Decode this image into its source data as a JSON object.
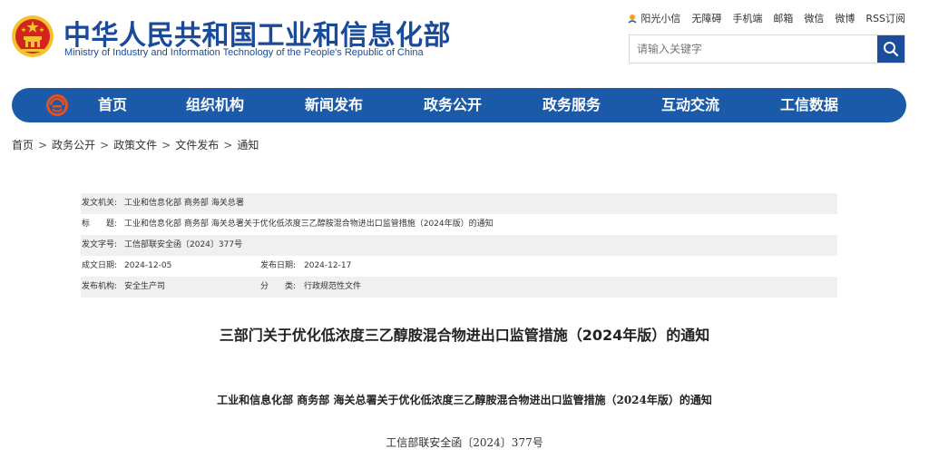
{
  "header": {
    "title": "中华人民共和国工业和信息化部",
    "subtitle": "Ministry of Industry and Information Technology of the People's Republic of China",
    "emblem_icon": "national-emblem-icon",
    "colors": {
      "brand": "#1a4a9a",
      "nav": "#1a5aa8",
      "emblem_red": "#d4241c",
      "emblem_gold": "#f4c430"
    }
  },
  "toplinks": {
    "items": [
      "阳光小信",
      "无障碍",
      "手机端",
      "邮箱",
      "微信",
      "微博",
      "RSS订阅"
    ],
    "first_icon": "sun-icon"
  },
  "search": {
    "placeholder": "请输入关键字",
    "value": "",
    "button_icon": "search-icon"
  },
  "nav": {
    "logo_icon": "ministry-logo-icon",
    "items": [
      "首页",
      "组织机构",
      "新闻发布",
      "政务公开",
      "政务服务",
      "互动交流",
      "工信数据"
    ]
  },
  "breadcrumb": {
    "items": [
      "首页",
      "政务公开",
      "政策文件",
      "文件发布",
      "通知"
    ],
    "separator": ">"
  },
  "meta": {
    "issuer_label": "发文机关:",
    "issuer_value": "工业和信息化部 商务部 海关总署",
    "title_label": "标　　题:",
    "title_value": "工业和信息化部 商务部 海关总署关于优化低浓度三乙醇胺混合物进出口监管措施（2024年版）的通知",
    "docno_label": "发文字号:",
    "docno_value": "工信部联安全函〔2024〕377号",
    "created_label": "成文日期:",
    "created_value": "2024-12-05",
    "published_label": "发布日期:",
    "published_value": "2024-12-17",
    "agency_label": "发布机构:",
    "agency_value": "安全生产司",
    "category_label": "分　　类:",
    "category_value": "行政规范性文件"
  },
  "article": {
    "title": "三部门关于优化低浓度三乙醇胺混合物进出口监管措施（2024年版）的通知",
    "subtitle": "工业和信息化部 商务部 海关总署关于优化低浓度三乙醇胺混合物进出口监管措施（2024年版）的通知",
    "doc_number": "工信部联安全函〔2024〕377号"
  }
}
